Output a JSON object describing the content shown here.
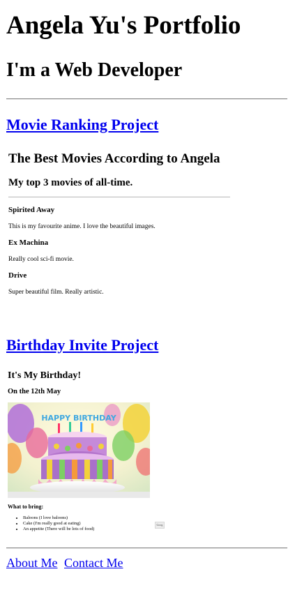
{
  "page": {
    "title": "Angela Yu's Portfolio",
    "subtitle": "I'm a Web Developer"
  },
  "projects": [
    {
      "link_label": "Movie Ranking Project",
      "embed": {
        "heading": "The Best Movies According to Angela",
        "subheading": "My top 3 movies of all-time.",
        "movies": [
          {
            "title": "Spirited Away",
            "desc": "This is my favourite anime. I love the beautiful images."
          },
          {
            "title": "Ex Machina",
            "desc": "Really cool sci-fi movie."
          },
          {
            "title": "Drive",
            "desc": "Super beautiful film. Really artistic."
          }
        ]
      }
    },
    {
      "link_label": "Birthday Invite Project",
      "embed": {
        "heading": "It's My Birthday!",
        "date": "On the 12th May",
        "cake_text": "HAPPY BIRTHDAY",
        "bring_label": "What to bring:",
        "items": [
          "Baloons (I love baloons)",
          "Cake (I'm really good at eating)",
          "An appetite (There will be lots of food)"
        ],
        "map_button": "Goog"
      }
    }
  ],
  "footer": {
    "about": "About Me",
    "contact": "Contact Me"
  },
  "colors": {
    "link": "#0000ee",
    "rule": "#8a8a8a"
  }
}
